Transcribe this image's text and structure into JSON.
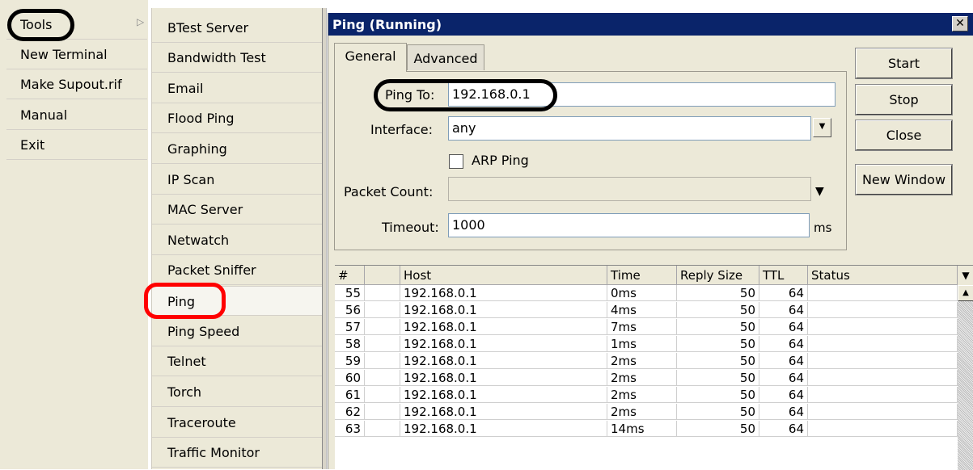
{
  "main_menu": {
    "items": [
      "Tools",
      "New Terminal",
      "Make Supout.rif",
      "Manual",
      "Exit"
    ],
    "submenu_arrow": "▷"
  },
  "tools_submenu": {
    "items": [
      "BTest Server",
      "Bandwidth Test",
      "Email",
      "Flood Ping",
      "Graphing",
      "IP Scan",
      "MAC Server",
      "Netwatch",
      "Packet Sniffer",
      "Ping",
      "Ping Speed",
      "Telnet",
      "Torch",
      "Traceroute",
      "Traffic Monitor"
    ],
    "selected": "Ping"
  },
  "ping_window": {
    "title": "Ping (Running)",
    "close_glyph": "✕",
    "tabs": [
      "General",
      "Advanced"
    ],
    "fields": {
      "ping_to_label": "Ping To:",
      "ping_to_value": "192.168.0.1",
      "interface_label": "Interface:",
      "interface_value": "any",
      "arp_ping_label": "ARP Ping",
      "packet_count_label": "Packet Count:",
      "packet_count_value": "",
      "timeout_label": "Timeout:",
      "timeout_value": "1000",
      "timeout_unit": "ms"
    },
    "buttons": [
      "Start",
      "Stop",
      "Close",
      "New Window"
    ],
    "table": {
      "columns": [
        "#",
        "",
        "Host",
        "Time",
        "Reply Size",
        "TTL",
        "Status"
      ],
      "rows": [
        [
          "55",
          "",
          "192.168.0.1",
          "0ms",
          "50",
          "64",
          ""
        ],
        [
          "56",
          "",
          "192.168.0.1",
          "4ms",
          "50",
          "64",
          ""
        ],
        [
          "57",
          "",
          "192.168.0.1",
          "7ms",
          "50",
          "64",
          ""
        ],
        [
          "58",
          "",
          "192.168.0.1",
          "1ms",
          "50",
          "64",
          ""
        ],
        [
          "59",
          "",
          "192.168.0.1",
          "2ms",
          "50",
          "64",
          ""
        ],
        [
          "60",
          "",
          "192.168.0.1",
          "2ms",
          "50",
          "64",
          ""
        ],
        [
          "61",
          "",
          "192.168.0.1",
          "2ms",
          "50",
          "64",
          ""
        ],
        [
          "62",
          "",
          "192.168.0.1",
          "2ms",
          "50",
          "64",
          ""
        ],
        [
          "63",
          "",
          "192.168.0.1",
          "14ms",
          "50",
          "64",
          ""
        ]
      ]
    }
  },
  "colors": {
    "title_bar": "#0a246a",
    "panel_bg": "#ece9d8",
    "highlight_red": "#ff0000",
    "highlight_black": "#000000"
  }
}
